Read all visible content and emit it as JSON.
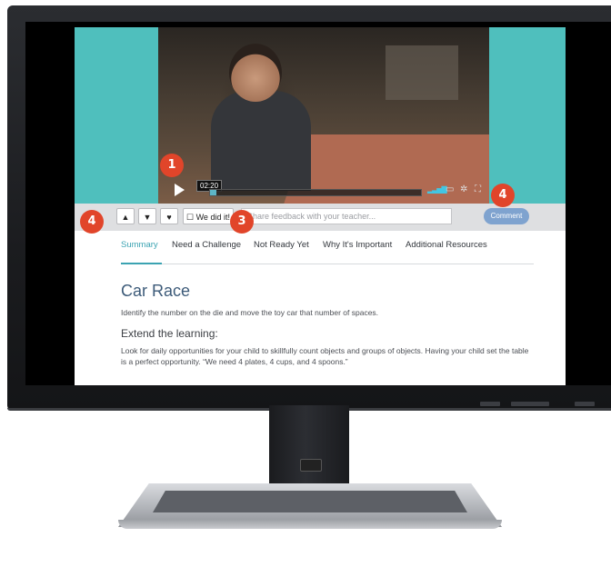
{
  "video": {
    "timestamp": "02:20",
    "progress_fraction": 0.03,
    "icons": [
      "play-icon",
      "volume-icon",
      "captions-icon",
      "settings-icon",
      "fullscreen-icon"
    ]
  },
  "feedback": {
    "like_icon": "thumbs-up-icon",
    "dislike_icon": "thumbs-down-icon",
    "heart_icon": "heart-icon",
    "we_did_it_label": "☐ We did it!",
    "input_placeholder": "Share feedback with your teacher...",
    "comment_label": "Comment"
  },
  "tabs": [
    {
      "label": "Summary",
      "active": true
    },
    {
      "label": "Need a Challenge"
    },
    {
      "label": "Not Ready Yet"
    },
    {
      "label": "Why It's Important"
    },
    {
      "label": "Additional Resources"
    }
  ],
  "activity": {
    "title": "Car Race",
    "description": "Identify the number on the die and move the toy car that number of spaces.",
    "subheading": "Extend the learning:",
    "body": "Look for daily opportunities for your child to skillfully count objects and groups of objects. Having your child set the table is a perfect opportunity. “We need 4 plates, 4 cups, and 4 spoons.”"
  },
  "callouts": [
    "1",
    "4",
    "3",
    "4"
  ],
  "colors": {
    "accent_teal": "#4fbfbd",
    "callout_red": "#e1452a",
    "comment_button": "#7fa3cf",
    "active_tab": "#3ba3b2"
  }
}
